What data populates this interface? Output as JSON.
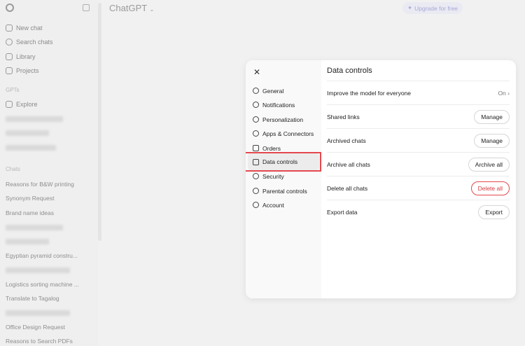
{
  "sidebar": {
    "nav": [
      "New chat",
      "Search chats",
      "Library",
      "Projects"
    ],
    "gpts_label": "GPTs",
    "explore": "Explore",
    "chats_label": "Chats",
    "chats": [
      "Reasons for B&W printing",
      "Synonym Request",
      "Brand name ideas",
      "Egyptian pyramid constru...",
      "Logistics sorting machine ...",
      "Translate to Tagalog",
      "Office Design Request",
      "Reasons to Search PDFs"
    ]
  },
  "header": {
    "title": "ChatGPT",
    "upgrade": "Upgrade for free"
  },
  "settings": {
    "nav": [
      "General",
      "Notifications",
      "Personalization",
      "Apps & Connectors",
      "Orders",
      "Data controls",
      "Security",
      "Parental controls",
      "Account"
    ],
    "title": "Data controls",
    "rows": [
      {
        "label": "Improve the model for everyone",
        "value": "On"
      },
      {
        "label": "Shared links",
        "button": "Manage"
      },
      {
        "label": "Archived chats",
        "button": "Manage"
      },
      {
        "label": "Archive all chats",
        "button": "Archive all"
      },
      {
        "label": "Delete all chats",
        "button": "Delete all"
      },
      {
        "label": "Export data",
        "button": "Export"
      }
    ]
  }
}
